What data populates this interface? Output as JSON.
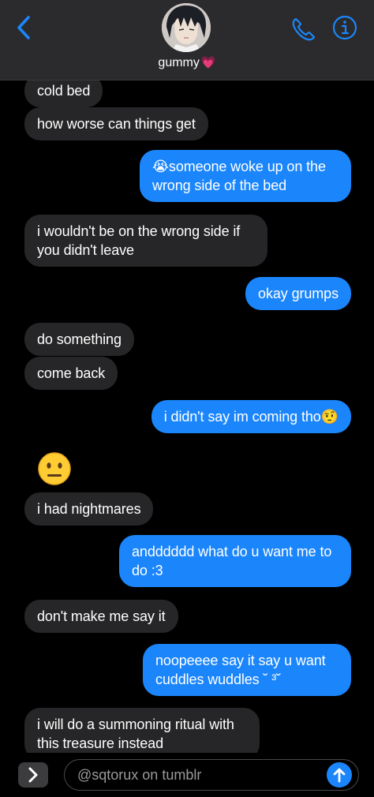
{
  "header": {
    "contact_name": "gummy",
    "contact_emoji": "💗"
  },
  "colors": {
    "outgoing": "#1b86fb",
    "incoming": "#262628",
    "accent": "#1b86fb",
    "background": "#000000"
  },
  "messages": [
    {
      "side": "in",
      "text": "cold bed"
    },
    {
      "side": "in",
      "text": "how worse can things get"
    },
    {
      "side": "out",
      "text": "😭someone woke up on the wrong side of the bed"
    },
    {
      "side": "in",
      "text": "i wouldn't be on the wrong side if you didn't leave"
    },
    {
      "side": "out",
      "text": "okay grumps"
    },
    {
      "side": "in",
      "text": "do something"
    },
    {
      "side": "in",
      "text": "come back"
    },
    {
      "side": "out",
      "text": "i didn't say im coming tho🤨"
    },
    {
      "side": "in",
      "text": "😐"
    },
    {
      "side": "in",
      "text": "i had nightmares"
    },
    {
      "side": "out",
      "text": "andddddd what do u want me to do :3"
    },
    {
      "side": "in",
      "text": "don't make me say it"
    },
    {
      "side": "out",
      "text": "noopeeee say it say u want cuddles wuddles ˘ ³˘"
    },
    {
      "side": "in",
      "text": "i will do a summoning ritual with this treasure instead"
    }
  ],
  "composer": {
    "placeholder": "@sqtorux on tumblr"
  },
  "icons": {
    "back": "chevron-left-icon",
    "phone": "phone-icon",
    "info": "info-icon",
    "apps": "chevron-right-icon",
    "send": "arrow-up-icon"
  }
}
